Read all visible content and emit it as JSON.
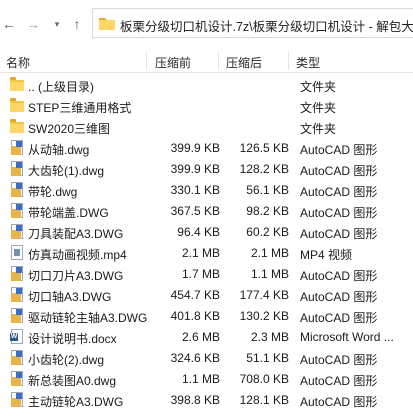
{
  "toolbar": {
    "back_icon": "←",
    "forward_icon": "→",
    "dropdown_icon": "▾",
    "up_icon": "↑",
    "address": "板栗分级切口机设计.7z\\板栗分级切口机设计 - 解包大小"
  },
  "columns": {
    "name": "名称",
    "date": "压缩前",
    "size": "压缩后",
    "type": "类型"
  },
  "rows": [
    {
      "icon": "folder",
      "name": ".. (上级目录)",
      "date": "",
      "size": "",
      "type": "文件夹"
    },
    {
      "icon": "folder",
      "name": "STEP三维通用格式",
      "date": "",
      "size": "",
      "type": "文件夹"
    },
    {
      "icon": "folder",
      "name": "SW2020三维图",
      "date": "",
      "size": "",
      "type": "文件夹"
    },
    {
      "icon": "dwg",
      "name": "从动轴.dwg",
      "date": "399.9 KB",
      "size": "126.5 KB",
      "type": "AutoCAD 图形"
    },
    {
      "icon": "dwg",
      "name": "大齿轮(1).dwg",
      "date": "399.9 KB",
      "size": "128.2 KB",
      "type": "AutoCAD 图形"
    },
    {
      "icon": "dwg",
      "name": "带轮.dwg",
      "date": "330.1 KB",
      "size": "56.1 KB",
      "type": "AutoCAD 图形"
    },
    {
      "icon": "dwg",
      "name": "带轮端盖.DWG",
      "date": "367.5 KB",
      "size": "98.2 KB",
      "type": "AutoCAD 图形"
    },
    {
      "icon": "dwg",
      "name": "刀具装配A3.DWG",
      "date": "96.4 KB",
      "size": "60.2 KB",
      "type": "AutoCAD 图形"
    },
    {
      "icon": "mp4",
      "name": "仿真动画视频.mp4",
      "date": "2.1 MB",
      "size": "2.1 MB",
      "type": "MP4 视频"
    },
    {
      "icon": "dwg",
      "name": "切口刀片A3.DWG",
      "date": "1.7 MB",
      "size": "1.1 MB",
      "type": "AutoCAD 图形"
    },
    {
      "icon": "dwg",
      "name": "切口轴A3.DWG",
      "date": "454.7 KB",
      "size": "177.4 KB",
      "type": "AutoCAD 图形"
    },
    {
      "icon": "dwg",
      "name": "驱动链轮主轴A3.DWG",
      "date": "401.8 KB",
      "size": "130.2 KB",
      "type": "AutoCAD 图形"
    },
    {
      "icon": "doc",
      "name": "设计说明书.docx",
      "date": "2.6 MB",
      "size": "2.3 MB",
      "type": "Microsoft Word ..."
    },
    {
      "icon": "dwg",
      "name": "小齿轮(2).dwg",
      "date": "324.6 KB",
      "size": "51.1 KB",
      "type": "AutoCAD 图形"
    },
    {
      "icon": "dwg",
      "name": "新总装图A0.dwg",
      "date": "1.1 MB",
      "size": "708.0 KB",
      "type": "AutoCAD 图形"
    },
    {
      "icon": "dwg",
      "name": "主动链轮A3.DWG",
      "date": "398.8 KB",
      "size": "128.1 KB",
      "type": "AutoCAD 图形"
    }
  ]
}
